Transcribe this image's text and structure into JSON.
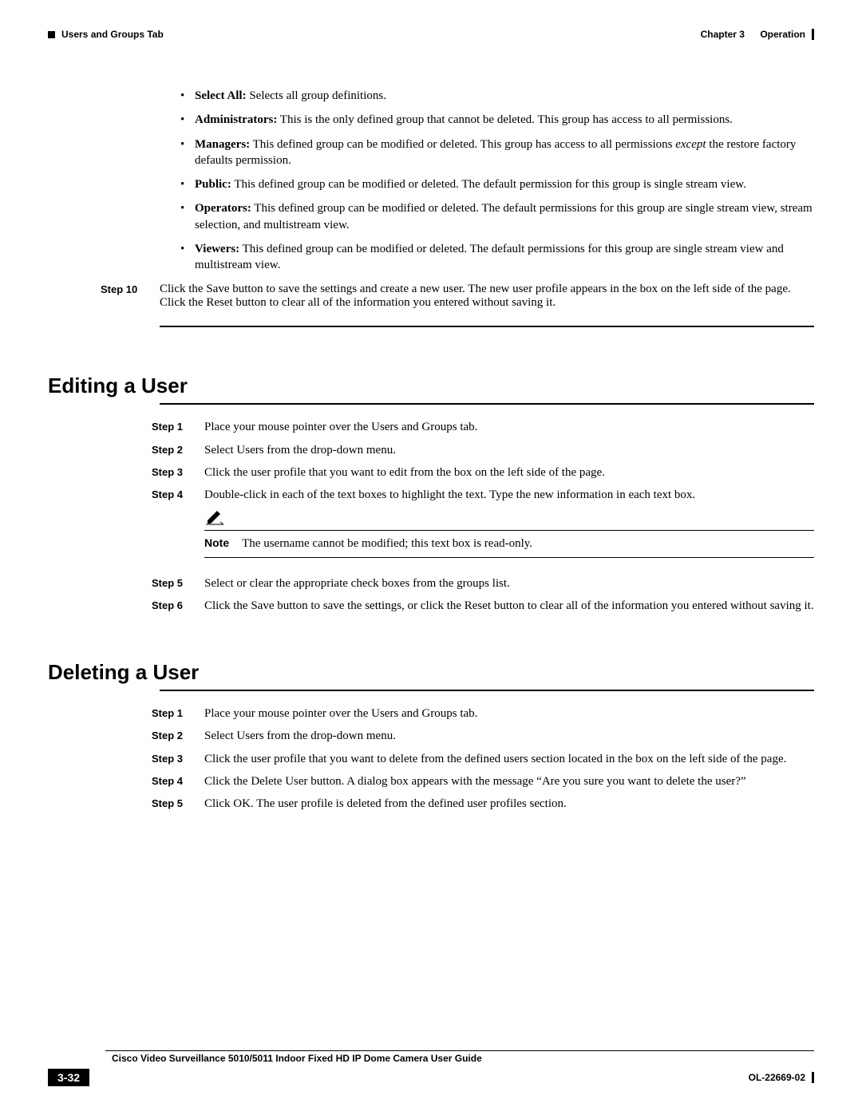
{
  "header": {
    "left": "Users and Groups Tab",
    "right_chapter": "Chapter 3",
    "right_title": "Operation"
  },
  "groups": [
    {
      "term": "Select All:",
      "desc": " Selects all group definitions."
    },
    {
      "term": "Administrators:",
      "desc": " This is the only defined group that cannot be deleted. This group has access to all permissions."
    },
    {
      "term": "Managers:",
      "desc_pre": " This defined group can be modified or deleted. This group has access to all permissions ",
      "desc_em": "except",
      "desc_post": " the restore factory defaults permission."
    },
    {
      "term": "Public:",
      "desc": " This defined group can be modified or deleted. The default permission for this group is single stream view."
    },
    {
      "term": "Operators:",
      "desc": " This defined group can be modified or deleted. The default permissions for this group are single stream view, stream selection, and multistream view."
    },
    {
      "term": "Viewers:",
      "desc": " This defined group can be modified or deleted. The default permissions for this group are single stream view and multistream view."
    }
  ],
  "step10": {
    "label": "Step 10",
    "text": "Click the Save button to save the settings and create a new user. The new user profile appears in the box on the left side of the page. Click the Reset button to clear all of the information you entered without saving it."
  },
  "editing": {
    "heading": "Editing a User",
    "steps": [
      {
        "label": "Step 1",
        "text": "Place your mouse pointer over the Users and Groups tab."
      },
      {
        "label": "Step 2",
        "text": "Select Users from the drop-down menu."
      },
      {
        "label": "Step 3",
        "text": "Click the user profile that you want to edit from the box on the left side of the page."
      },
      {
        "label": "Step 4",
        "text": "Double-click in each of the text boxes to highlight the text. Type the new information in each text box."
      }
    ],
    "note_label": "Note",
    "note_text": "The username cannot be modified; this text box is read-only.",
    "steps2": [
      {
        "label": "Step 5",
        "text": "Select or clear the appropriate check boxes from the groups list."
      },
      {
        "label": "Step 6",
        "text": "Click the Save button to save the settings, or click the Reset button to clear all of the information you entered without saving it."
      }
    ]
  },
  "deleting": {
    "heading": "Deleting a User",
    "steps": [
      {
        "label": "Step 1",
        "text": "Place your mouse pointer over the Users and Groups tab."
      },
      {
        "label": "Step 2",
        "text": "Select Users from the drop-down menu."
      },
      {
        "label": "Step 3",
        "text": "Click the user profile that you want to delete from the defined users section located in the box on the left side of the page."
      },
      {
        "label": "Step 4",
        "text": "Click the Delete User button. A dialog box appears with the message “Are you sure you want to delete the user?”"
      },
      {
        "label": "Step 5",
        "text": "Click OK. The user profile is deleted from the defined user profiles section."
      }
    ]
  },
  "footer": {
    "guide": "Cisco Video Surveillance 5010/5011 Indoor Fixed HD IP Dome Camera User Guide",
    "page": "3-32",
    "docid": "OL-22669-02"
  }
}
